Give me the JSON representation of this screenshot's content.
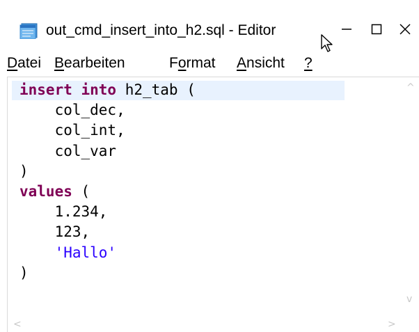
{
  "window": {
    "title": "out_cmd_insert_into_h2.sql - Editor",
    "app_icon": "notepad-icon",
    "controls": {
      "minimize_icon": "minimize-icon",
      "maximize_icon": "maximize-icon",
      "close_icon": "close-icon"
    }
  },
  "menu": {
    "items": [
      {
        "label": "Datei",
        "mnemonic": "D",
        "rest": "atei",
        "pre": ""
      },
      {
        "label": "Bearbeiten",
        "mnemonic": "B",
        "rest": "earbeiten",
        "pre": ""
      },
      {
        "label": "Format",
        "mnemonic": "o",
        "rest": "rmat",
        "pre": "F"
      },
      {
        "label": "Ansicht",
        "mnemonic": "A",
        "rest": "nsicht",
        "pre": ""
      },
      {
        "label": "?",
        "mnemonic": "?",
        "rest": "",
        "pre": ""
      }
    ]
  },
  "editor": {
    "lines": [
      [
        {
          "t": "insert into",
          "c": "kw"
        },
        {
          "t": " h2_tab (",
          "c": ""
        }
      ],
      [
        {
          "t": "    col_dec,",
          "c": ""
        }
      ],
      [
        {
          "t": "    col_int,",
          "c": ""
        }
      ],
      [
        {
          "t": "    col_var",
          "c": ""
        }
      ],
      [
        {
          "t": ")",
          "c": ""
        }
      ],
      [
        {
          "t": "values",
          "c": "kw"
        },
        {
          "t": " (",
          "c": ""
        }
      ],
      [
        {
          "t": "    1.234,",
          "c": ""
        }
      ],
      [
        {
          "t": "    123,",
          "c": ""
        }
      ],
      [
        {
          "t": "    ",
          "c": ""
        },
        {
          "t": "'Hallo'",
          "c": "str"
        }
      ],
      [
        {
          "t": ")",
          "c": ""
        }
      ]
    ],
    "colors": {
      "keyword": "#7f0055",
      "string": "#2a00ff",
      "current_line": "#e8f2fe"
    }
  },
  "scrollbars": {
    "up_icon": "scroll-up-icon",
    "down_icon": "scroll-down-icon",
    "left_icon": "scroll-left-icon",
    "right_icon": "scroll-right-icon",
    "up_glyph": "^",
    "down_glyph": "v",
    "left_glyph": "<",
    "right_glyph": ">"
  }
}
